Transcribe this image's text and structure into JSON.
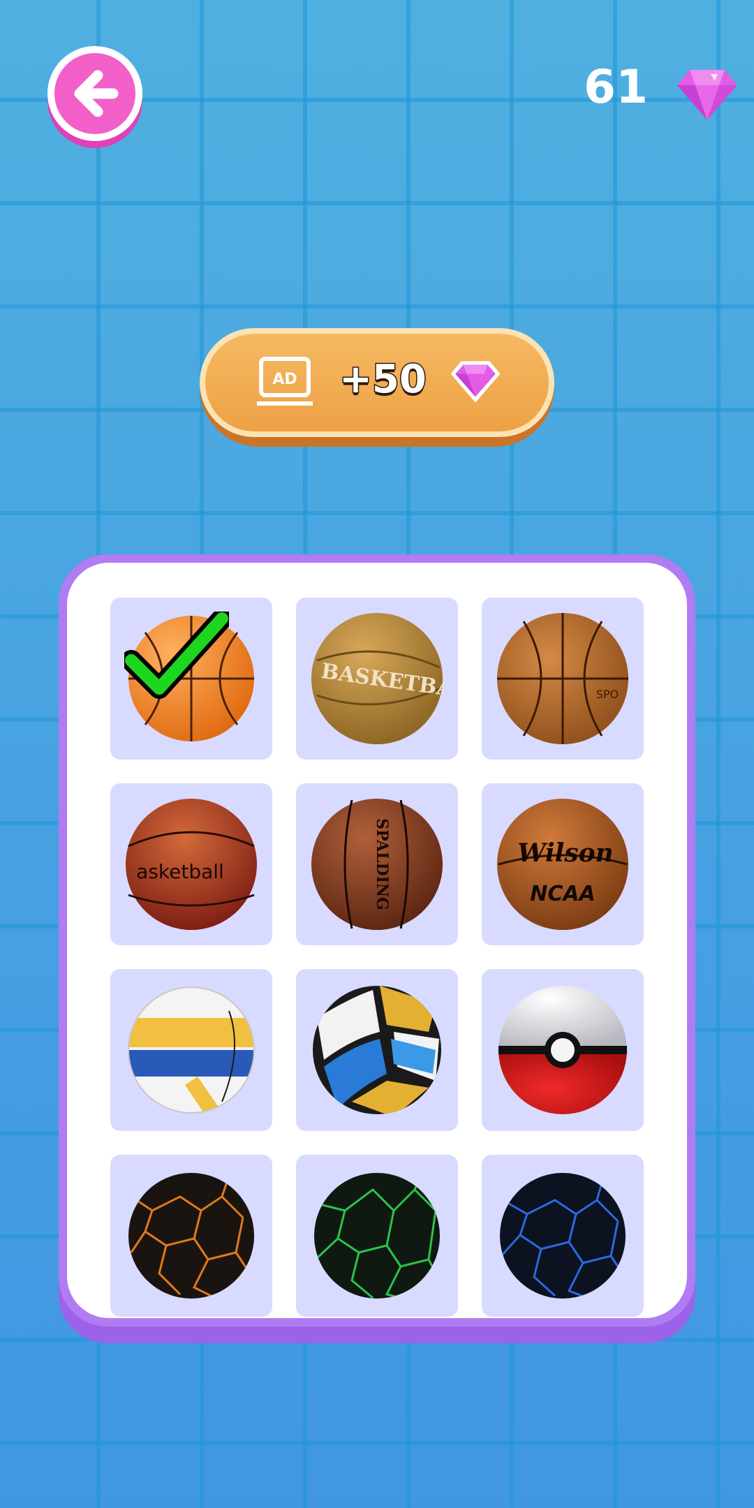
{
  "header": {
    "back_icon": "arrow-left-icon",
    "gem_count": "61",
    "gem_icon": "diamond-icon"
  },
  "ad_reward": {
    "badge": "AD",
    "amount": "+50",
    "gem_icon": "diamond-icon"
  },
  "ball_grid": {
    "selected_index": 0,
    "items": [
      {
        "icon": "basketball-orange-icon",
        "label_on_ball": ""
      },
      {
        "icon": "basketball-tan-icon",
        "label_on_ball": "BASKETBA"
      },
      {
        "icon": "basketball-worn-icon",
        "label_on_ball": "SPO"
      },
      {
        "icon": "basketball-red-icon",
        "label_on_ball": "asketball"
      },
      {
        "icon": "basketball-spalding-icon",
        "label_on_ball": "SPALDING"
      },
      {
        "icon": "basketball-wilson-icon",
        "label_on_ball": "Wilson",
        "label_on_ball_2": "NCAA"
      },
      {
        "icon": "volleyball-yellow-blue-icon",
        "label_on_ball": ""
      },
      {
        "icon": "volleyball-multicolor-icon",
        "label_on_ball": ""
      },
      {
        "icon": "pokeball-icon",
        "label_on_ball": ""
      },
      {
        "icon": "lava-ball-orange-icon",
        "label_on_ball": ""
      },
      {
        "icon": "lava-ball-green-icon",
        "label_on_ball": ""
      },
      {
        "icon": "lava-ball-blue-icon",
        "label_on_ball": ""
      }
    ]
  },
  "colors": {
    "back_button": "#f25fc9",
    "gem": "#e25ce6",
    "ad_button": "#eea146",
    "panel_border": "#b07cf2",
    "cell_bg": "#d8dbff"
  }
}
